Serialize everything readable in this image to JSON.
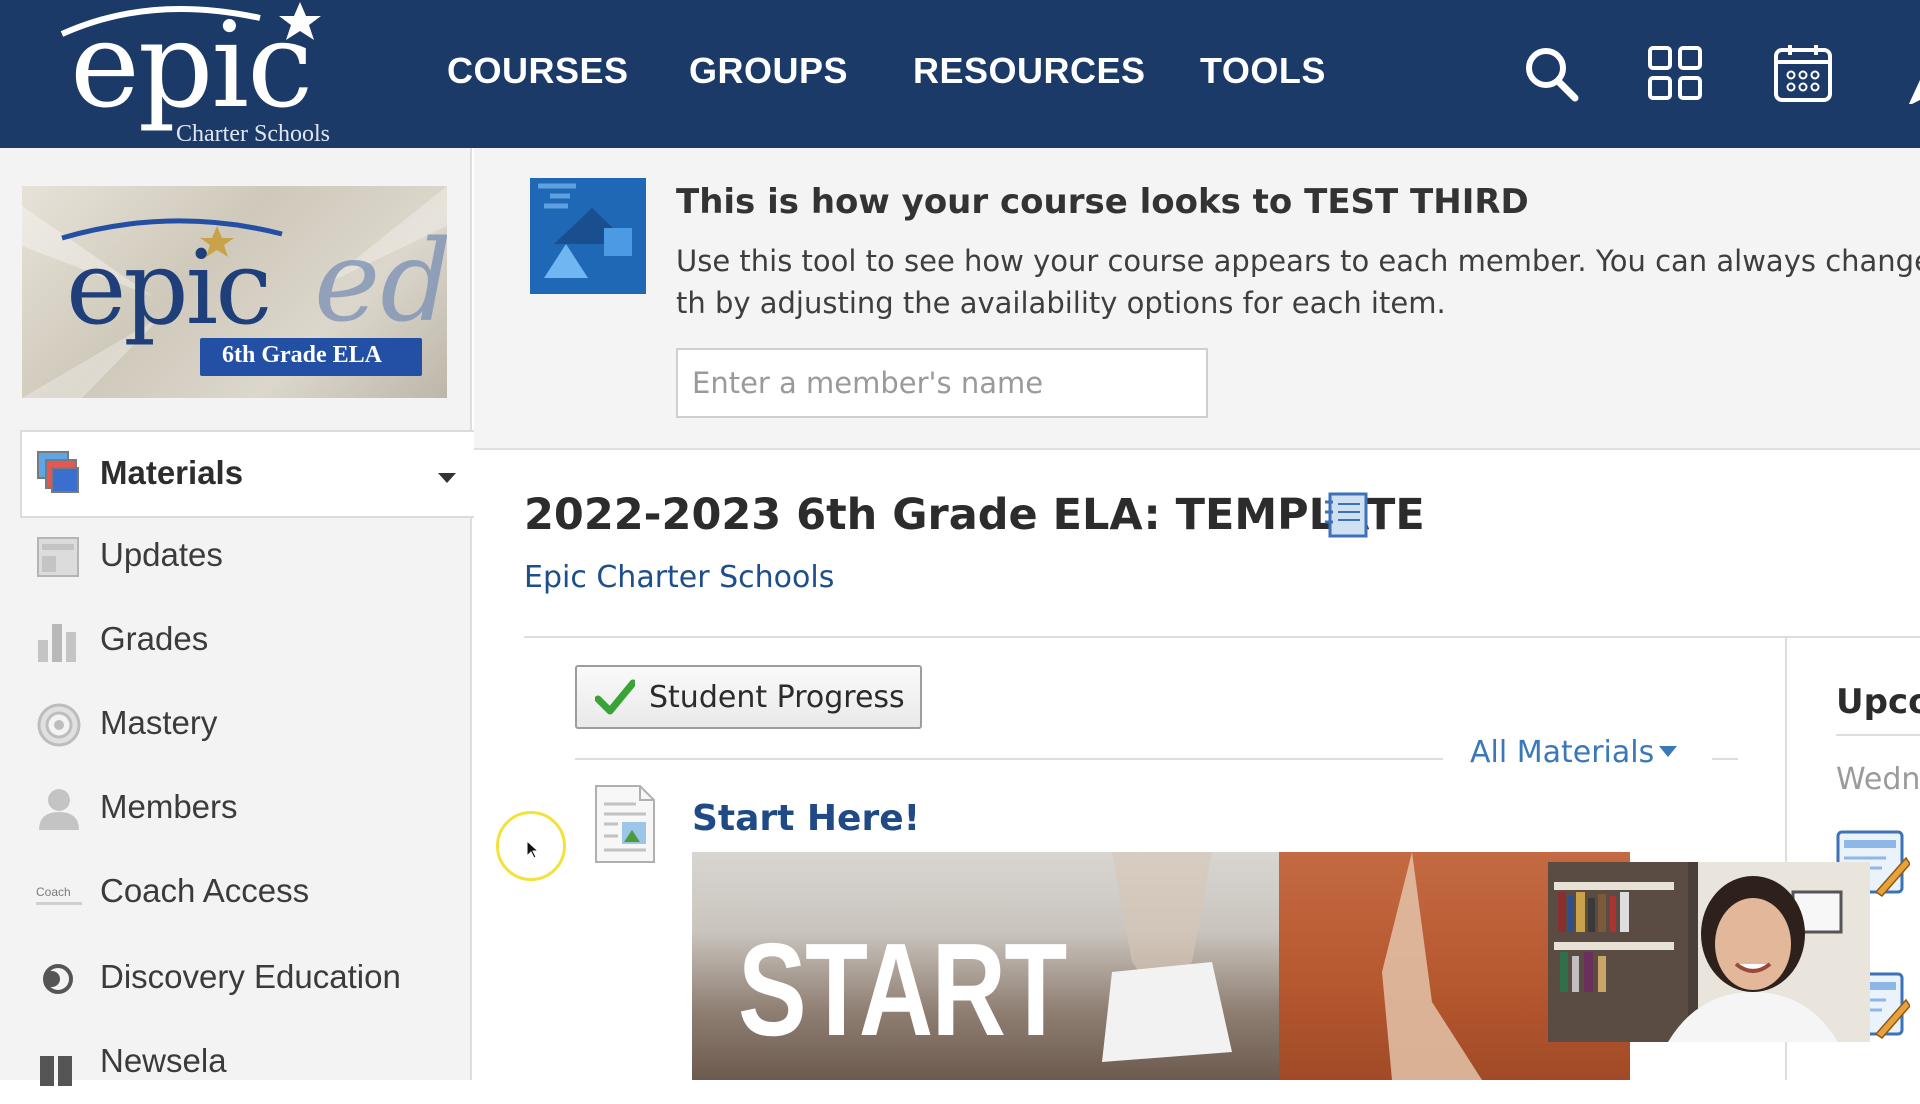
{
  "brand": {
    "logo_text": "epic",
    "logo_tagline": "Charter Schools",
    "primary_color": "#1c3a67",
    "link_color": "#1e4e8c"
  },
  "nav": {
    "items": [
      "COURSES",
      "GROUPS",
      "RESOURCES",
      "TOOLS"
    ],
    "icons": [
      "search-icon",
      "apps-grid-icon",
      "calendar-icon"
    ]
  },
  "sidebar": {
    "course_banner": {
      "word": "epic",
      "suffix": "ed",
      "ribbon": "6th Grade ELA"
    },
    "items": [
      {
        "label": "Materials",
        "icon": "materials-icon",
        "active": true
      },
      {
        "label": "Updates",
        "icon": "updates-icon"
      },
      {
        "label": "Grades",
        "icon": "grades-icon"
      },
      {
        "label": "Mastery",
        "icon": "mastery-icon"
      },
      {
        "label": "Members",
        "icon": "members-icon"
      },
      {
        "label": "Coach Access",
        "icon": "coach-access-icon"
      },
      {
        "label": "Discovery Education",
        "icon": "discovery-education-icon"
      },
      {
        "label": "Newsela",
        "icon": "newsela-icon"
      }
    ],
    "coach_icon_text": "Coach"
  },
  "preview": {
    "title": "This is how your course looks to TEST THIRD",
    "description": "Use this tool to see how your course appears to each member. You can always change th by adjusting the availability options for each item.",
    "input_placeholder": "Enter a member's name"
  },
  "course": {
    "title": "2022-2023 6th Grade ELA: TEMPLATE",
    "school": "Epic Charter Schools",
    "student_progress_label": "Student Progress",
    "filter_label": "All Materials",
    "upcoming_title": "Upco",
    "upcoming_day": "Wedn"
  },
  "materials": [
    {
      "title": "Start Here!",
      "image_text": "START"
    }
  ]
}
